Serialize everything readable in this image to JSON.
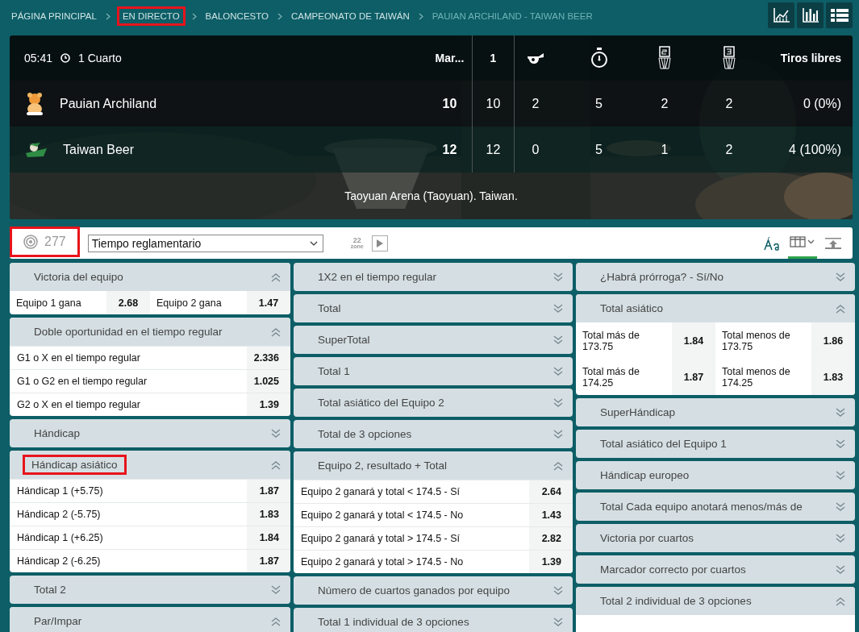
{
  "breadcrumb": [
    {
      "label": "PÁGINA PRINCIPAL",
      "current": false,
      "highlighted": false
    },
    {
      "label": "EN DIRECTO",
      "current": false,
      "highlighted": true
    },
    {
      "label": "BALONCESTO",
      "current": false,
      "highlighted": false
    },
    {
      "label": "CAMPEONATO DE TAIWÁN",
      "current": false,
      "highlighted": false
    },
    {
      "label": "PAUIAN ARCHILAND - TAIWAN BEER",
      "current": true,
      "highlighted": false
    }
  ],
  "view_buttons": [
    {
      "kind": "trend"
    },
    {
      "kind": "bars"
    },
    {
      "kind": "list"
    }
  ],
  "scoreboard": {
    "time": "05:41",
    "period": "1 Cuarto",
    "columns": [
      {
        "kind": "text",
        "label": "Mar..."
      },
      {
        "kind": "text",
        "label": "1"
      },
      {
        "kind": "whistle"
      },
      {
        "kind": "stopwatch"
      },
      {
        "kind": "two_points"
      },
      {
        "kind": "three_points"
      },
      {
        "kind": "text",
        "label": "Tiros libres"
      }
    ],
    "teams": [
      {
        "name": "Pauian Archiland",
        "values": [
          "10",
          "10",
          "2",
          "5",
          "2",
          "2",
          "0 (0%)"
        ]
      },
      {
        "name": "Taiwan Beer",
        "values": [
          "12",
          "12",
          "0",
          "5",
          "1",
          "2",
          "4 (100%)"
        ]
      }
    ],
    "venue": "Taoyuan Arena (Taoyuan). Taiwan."
  },
  "toolbar": {
    "markets_count": "277",
    "count_highlighted": true,
    "period_select": "Tiempo reglamentario",
    "zone_badge": [
      "22",
      "zone"
    ]
  },
  "columns": [
    [
      {
        "title": "Victoria del equipo",
        "expanded": true,
        "highlighted": false,
        "kind": "pairs",
        "rows": [
          [
            {
              "label": "Equipo 1 gana",
              "odds": "2.68"
            },
            {
              "label": "Equipo 2 gana",
              "odds": "1.47"
            }
          ]
        ]
      },
      {
        "title": "Doble oportunidad en el tiempo regular",
        "expanded": true,
        "highlighted": false,
        "kind": "list",
        "rows": [
          {
            "label": "G1 o X en el tiempo regular",
            "odds": "2.336"
          },
          {
            "label": "G1 o G2 en el tiempo regular",
            "odds": "1.025"
          },
          {
            "label": "G2 o X en el tiempo regular",
            "odds": "1.39"
          }
        ]
      },
      {
        "title": "Hándicap",
        "expanded": false,
        "highlighted": false
      },
      {
        "title": "Hándicap asiático",
        "expanded": true,
        "highlighted": true,
        "kind": "list",
        "rows": [
          {
            "label": "Hándicap 1 (+5.75)",
            "odds": "1.87"
          },
          {
            "label": "Hándicap 2 (-5.75)",
            "odds": "1.83"
          },
          {
            "label": "Hándicap 1 (+6.25)",
            "odds": "1.84"
          },
          {
            "label": "Hándicap 2 (-6.25)",
            "odds": "1.87"
          }
        ]
      },
      {
        "title": "Total 2",
        "expanded": false,
        "highlighted": false
      },
      {
        "title": "Par/Impar",
        "expanded": true,
        "highlighted": false
      }
    ],
    [
      {
        "title": "1X2 en el tiempo regular",
        "expanded": false,
        "highlighted": false
      },
      {
        "title": "Total",
        "expanded": false,
        "highlighted": false
      },
      {
        "title": "SuperTotal",
        "expanded": false,
        "highlighted": false
      },
      {
        "title": "Total 1",
        "expanded": false,
        "highlighted": false
      },
      {
        "title": "Total asiático del Equipo 2",
        "expanded": false,
        "highlighted": false
      },
      {
        "title": "Total de 3 opciones",
        "expanded": false,
        "highlighted": false
      },
      {
        "title": "Equipo 2, resultado + Total",
        "expanded": true,
        "highlighted": false,
        "kind": "list",
        "rows": [
          {
            "label": "Equipo 2 ganará y total < 174.5 - Sí",
            "odds": "2.64"
          },
          {
            "label": "Equipo 2 ganará y total < 174.5 - No",
            "odds": "1.43"
          },
          {
            "label": "Equipo 2 ganará y total > 174.5 - Sí",
            "odds": "2.82"
          },
          {
            "label": "Equipo 2 ganará y total > 174.5 - No",
            "odds": "1.39"
          }
        ]
      },
      {
        "title": "Número de cuartos ganados por equipo",
        "expanded": false,
        "highlighted": false
      },
      {
        "title": "Total 1 individual de 3 opciones",
        "expanded": false,
        "highlighted": false
      }
    ],
    [
      {
        "title": "¿Habrá prórroga? - Sí/No",
        "expanded": false,
        "highlighted": false
      },
      {
        "title": "Total asiático",
        "expanded": true,
        "highlighted": false,
        "kind": "pairs",
        "rows": [
          [
            {
              "label": "Total más de 173.75",
              "odds": "1.84"
            },
            {
              "label": "Total menos de 173.75",
              "odds": "1.86"
            }
          ],
          [
            {
              "label": "Total más de 174.25",
              "odds": "1.87"
            },
            {
              "label": "Total menos de 174.25",
              "odds": "1.83"
            }
          ]
        ]
      },
      {
        "title": "SuperHándicap",
        "expanded": false,
        "highlighted": false
      },
      {
        "title": "Total asiático del Equipo 1",
        "expanded": false,
        "highlighted": false
      },
      {
        "title": "Hándicap europeo",
        "expanded": false,
        "highlighted": false
      },
      {
        "title": "Total Cada equipo anotará menos/más de",
        "expanded": false,
        "highlighted": false
      },
      {
        "title": "Victoria por cuartos",
        "expanded": false,
        "highlighted": false
      },
      {
        "title": "Marcador correcto por cuartos",
        "expanded": false,
        "highlighted": false
      },
      {
        "title": "Total 2 individual de 3 opciones",
        "expanded": true,
        "highlighted": false
      }
    ]
  ]
}
